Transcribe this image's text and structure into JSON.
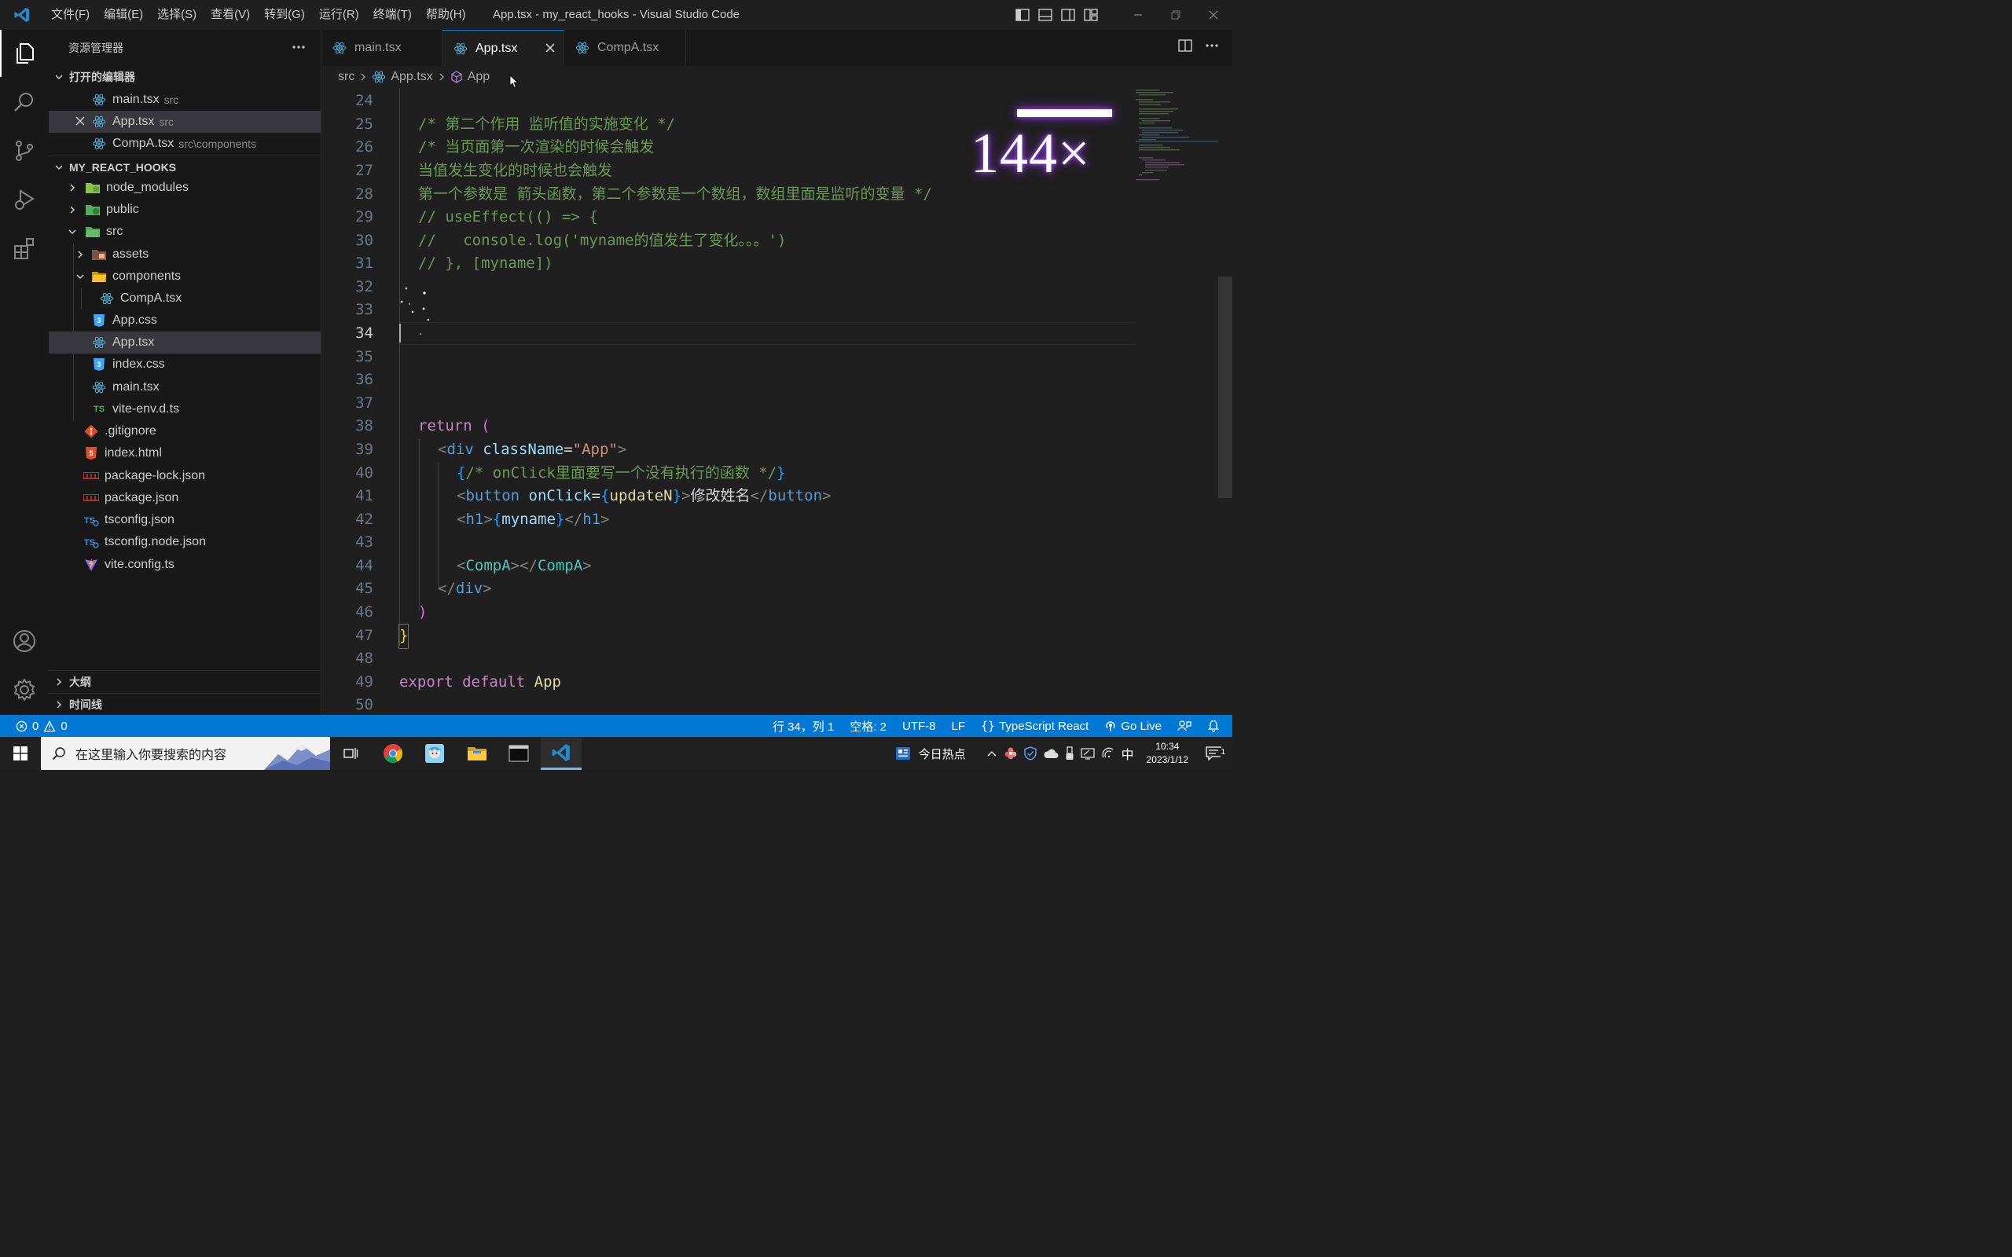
{
  "window": {
    "title": "App.tsx - my_react_hooks - Visual Studio Code",
    "menu": [
      "文件(F)",
      "编辑(E)",
      "选择(S)",
      "查看(V)",
      "转到(G)",
      "运行(R)",
      "终端(T)",
      "帮助(H)"
    ]
  },
  "colors": {
    "accent": "#0078d4",
    "react_icon": "#519aba",
    "comment": "#6a9955",
    "keyword": "#c586c0",
    "component": "#4ec9b0",
    "zoom_glow": "#8a2be2"
  },
  "sidebar": {
    "title": "资源管理器",
    "open_editors_title": "打开的编辑器",
    "open_editors": [
      {
        "name": "main.tsx",
        "desc": "src",
        "icon": "react-icon"
      },
      {
        "name": "App.tsx",
        "desc": "src",
        "icon": "react-icon"
      },
      {
        "name": "CompA.tsx",
        "desc": "src\\components",
        "icon": "react-icon"
      }
    ],
    "project_title": "MY_REACT_HOOKS",
    "tree": [
      {
        "name": "node_modules",
        "icon": "node-folder-icon"
      },
      {
        "name": "public",
        "icon": "public-folder-icon"
      },
      {
        "name": "src",
        "icon": "src-folder-icon"
      },
      {
        "name": "assets",
        "icon": "assets-folder-icon"
      },
      {
        "name": "components",
        "icon": "components-folder-icon"
      },
      {
        "name": "CompA.tsx",
        "icon": "react-icon"
      },
      {
        "name": "App.css",
        "icon": "css-icon"
      },
      {
        "name": "App.tsx",
        "icon": "react-icon"
      },
      {
        "name": "index.css",
        "icon": "css-icon"
      },
      {
        "name": "main.tsx",
        "icon": "react-icon"
      },
      {
        "name": "vite-env.d.ts",
        "icon": "ts-icon",
        "icon_text": "TS"
      },
      {
        "name": ".gitignore",
        "icon": "git-icon"
      },
      {
        "name": "index.html",
        "icon": "html-icon"
      },
      {
        "name": "package-lock.json",
        "icon": "npm-icon"
      },
      {
        "name": "package.json",
        "icon": "npm-icon"
      },
      {
        "name": "tsconfig.json",
        "icon": "tsconfig-icon"
      },
      {
        "name": "tsconfig.node.json",
        "icon": "tsconfig-icon"
      },
      {
        "name": "vite.config.ts",
        "icon": "vite-icon"
      }
    ],
    "outline_title": "大纲",
    "timeline_title": "时间线"
  },
  "tabs": [
    {
      "label": "main.tsx",
      "active": false
    },
    {
      "label": "App.tsx",
      "active": true
    },
    {
      "label": "CompA.tsx",
      "active": false
    }
  ],
  "breadcrumb": [
    "src",
    "App.tsx",
    "App"
  ],
  "editor": {
    "line_numbers": [
      "24",
      "25",
      "26",
      "27",
      "28",
      "29",
      "30",
      "31",
      "32",
      "33",
      "34",
      "35",
      "36",
      "37",
      "38",
      "39",
      "40",
      "41",
      "42",
      "43",
      "44",
      "45",
      "46",
      "47",
      "48",
      "49",
      "50"
    ],
    "current_line": "34",
    "lines": {
      "l25": "/* 第二个作用 监听值的实施变化 */",
      "l26": "/* 当页面第一次渲染的时候会触发",
      "l27": "当值发生变化的时候也会触发",
      "l28": "第一个参数是 箭头函数，第二个参数是一个数组，数组里面是监听的变量 */",
      "l29": "// useEffect(() => {",
      "l30": "//   console.log('myname的值发生了变化。。。')",
      "l31": "// }, [myname])",
      "l38_kw": "return",
      "l38_paren": "(",
      "l39_open": "<",
      "l39_tag": "div",
      "l39_attr": "className",
      "l39_eq": "=",
      "l39_str": "\"App\"",
      "l39_close": ">",
      "l40_open": "{",
      "l40_comment": "/* onClick里面要写一个没有执行的函数 */",
      "l40_close": "}",
      "l41_open": "<",
      "l41_tag": "button",
      "l41_attr": "onClick",
      "l41_eq": "=",
      "l41_brace_open": "{",
      "l41_fn": "updateN",
      "l41_brace_close": "}",
      "l41_gt": ">",
      "l41_text": "修改姓名",
      "l41_end_open": "</",
      "l41_end_tag": "button",
      "l41_end_close": ">",
      "l42_open": "<",
      "l42_tag": "h1",
      "l42_gt": ">",
      "l42_brace_open": "{",
      "l42_var": "myname",
      "l42_brace_close": "}",
      "l42_end_open": "</",
      "l42_end_tag": "h1",
      "l42_end_close": ">",
      "l44_open": "<",
      "l44_tag": "CompA",
      "l44_mid": "></",
      "l44_tag2": "CompA",
      "l44_close": ">",
      "l45_open": "</",
      "l45_tag": "div",
      "l45_close": ">",
      "l46": ")",
      "l47": "}",
      "l49_kw1": "export",
      "l49_kw2": "default",
      "l49_name": "App"
    },
    "zoom_overlay": "144×"
  },
  "statusbar": {
    "errors": "0",
    "warnings": "0",
    "position": "行 34，列 1",
    "spaces": "空格: 2",
    "encoding": "UTF-8",
    "eol": "LF",
    "language": "TypeScript React",
    "golive": "Go Live"
  },
  "taskbar": {
    "search_placeholder": "在这里输入你要搜索的内容",
    "news_label": "今日热点",
    "ime": "中",
    "time": "10:34",
    "date": "2023/1/12",
    "notification_count": "1"
  }
}
